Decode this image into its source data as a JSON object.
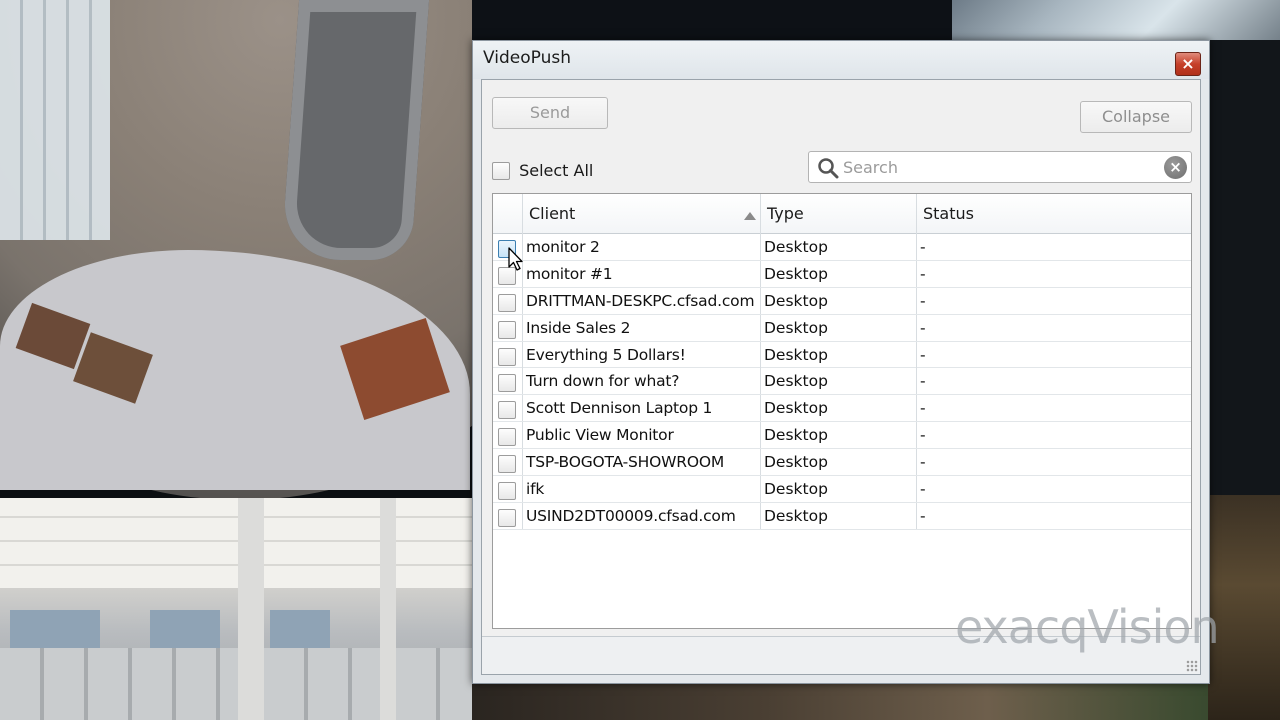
{
  "window": {
    "title": "VideoPush",
    "close_icon": "×"
  },
  "toolbar": {
    "send_label": "Send",
    "collapse_label": "Collapse"
  },
  "select_all": {
    "label": "Select All",
    "checked": false
  },
  "search": {
    "placeholder": "Search",
    "value": "",
    "clear_icon": "×"
  },
  "table": {
    "columns": [
      "Client",
      "Type",
      "Status"
    ],
    "sort_column": "Client",
    "sort_direction": "ascending",
    "rows": [
      {
        "client": "monitor 2",
        "type": "Desktop",
        "status": "-"
      },
      {
        "client": "monitor #1",
        "type": "Desktop",
        "status": "-"
      },
      {
        "client": "DRITTMAN-DESKPC.cfsad.com",
        "type": "Desktop",
        "status": "-"
      },
      {
        "client": "Inside Sales 2",
        "type": "Desktop",
        "status": "-"
      },
      {
        "client": "Everything 5 Dollars!",
        "type": "Desktop",
        "status": "-"
      },
      {
        "client": "Turn down for what?",
        "type": "Desktop",
        "status": "-"
      },
      {
        "client": "Scott Dennison Laptop 1",
        "type": "Desktop",
        "status": "-"
      },
      {
        "client": "Public View Monitor",
        "type": "Desktop",
        "status": "-"
      },
      {
        "client": "TSP-BOGOTA-SHOWROOM",
        "type": "Desktop",
        "status": "-"
      },
      {
        "client": "ifk",
        "type": "Desktop",
        "status": "-"
      },
      {
        "client": "USIND2DT00009.cfsad.com",
        "type": "Desktop",
        "status": "-"
      }
    ]
  },
  "watermark": "exacqVision",
  "colors": {
    "close_button": "#c6402a",
    "checkbox_hover_border": "#3c7fb1",
    "disabled_text": "#9a9a9a"
  }
}
